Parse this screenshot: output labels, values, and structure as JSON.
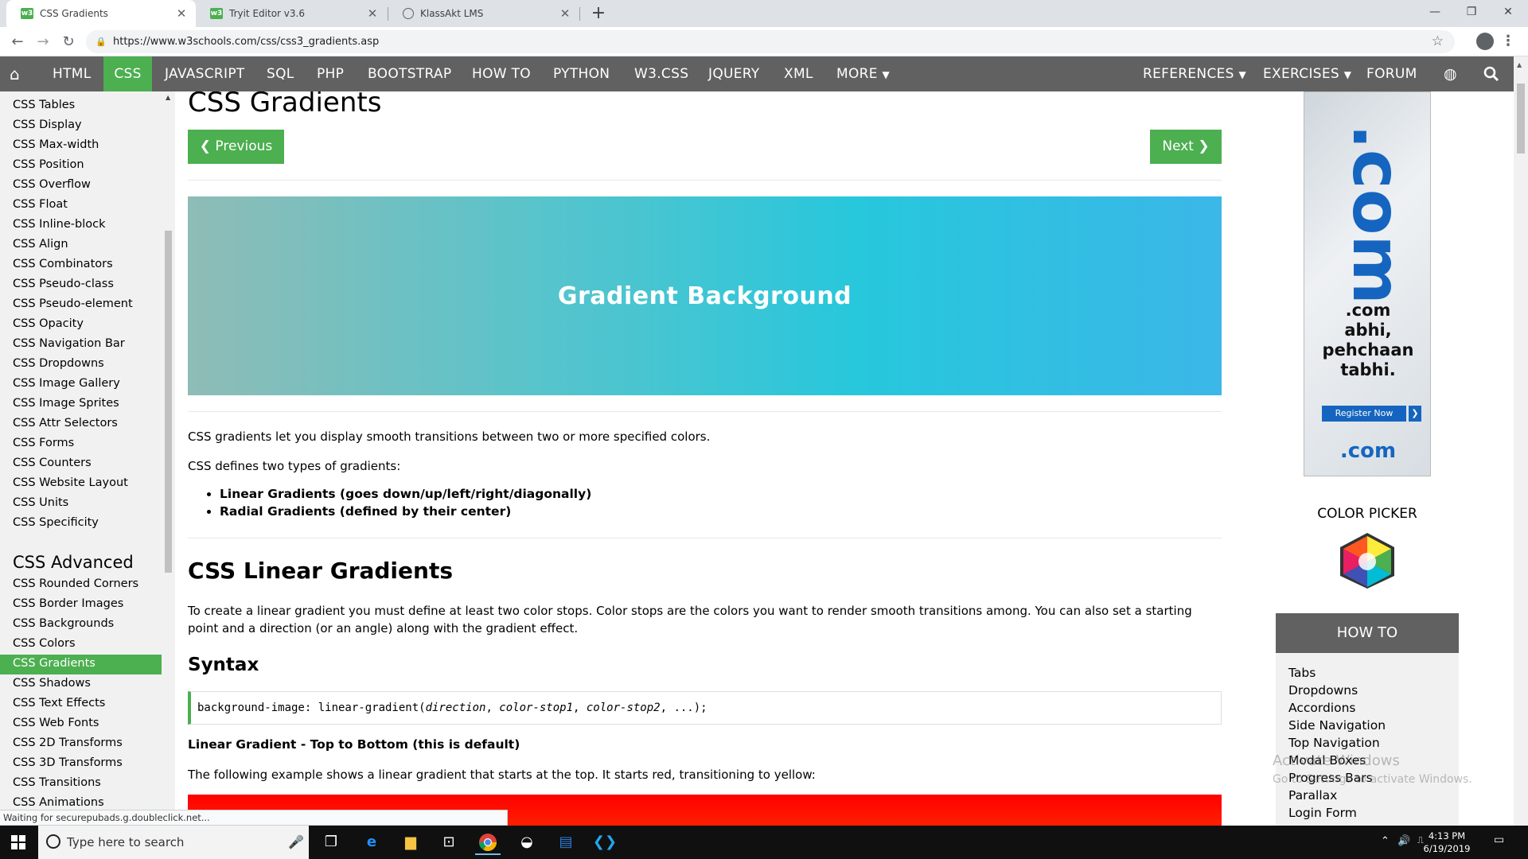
{
  "browser": {
    "tabs": [
      {
        "title": "CSS Gradients",
        "favicon": "w3schools-icon"
      },
      {
        "title": "Tryit Editor v3.6",
        "favicon": "w3schools-icon"
      },
      {
        "title": "KlassAkt LMS",
        "favicon": "globe-icon"
      }
    ],
    "url": "https://www.w3schools.com/css/css3_gradients.asp"
  },
  "topnav": {
    "items": [
      "HTML",
      "CSS",
      "JAVASCRIPT",
      "SQL",
      "PHP",
      "BOOTSTRAP",
      "HOW TO",
      "PYTHON",
      "W3.CSS",
      "JQUERY",
      "XML",
      "MORE"
    ],
    "active": "CSS",
    "right": [
      "REFERENCES",
      "EXERCISES",
      "FORUM"
    ]
  },
  "sidebar": {
    "items": [
      "CSS Tables",
      "CSS Display",
      "CSS Max-width",
      "CSS Position",
      "CSS Overflow",
      "CSS Float",
      "CSS Inline-block",
      "CSS Align",
      "CSS Combinators",
      "CSS Pseudo-class",
      "CSS Pseudo-element",
      "CSS Opacity",
      "CSS Navigation Bar",
      "CSS Dropdowns",
      "CSS Image Gallery",
      "CSS Image Sprites",
      "CSS Attr Selectors",
      "CSS Forms",
      "CSS Counters",
      "CSS Website Layout",
      "CSS Units",
      "CSS Specificity"
    ],
    "heading": "CSS Advanced",
    "advanced": [
      "CSS Rounded Corners",
      "CSS Border Images",
      "CSS Backgrounds",
      "CSS Colors",
      "CSS Gradients",
      "CSS Shadows",
      "CSS Text Effects",
      "CSS Web Fonts",
      "CSS 2D Transforms",
      "CSS 3D Transforms",
      "CSS Transitions",
      "CSS Animations"
    ],
    "active": "CSS Gradients"
  },
  "main": {
    "title": "CSS Gradients",
    "prev_label": "❮ Previous",
    "next_label": "Next ❯",
    "gradient_text": "Gradient Background",
    "intro1": "CSS gradients let you display smooth transitions between two or more specified colors.",
    "intro2": "CSS defines two types of gradients:",
    "types": [
      "Linear Gradients (goes down/up/left/right/diagonally)",
      "Radial Gradients (defined by their center)"
    ],
    "linear_heading": "CSS Linear Gradients",
    "linear_p1": "To create a linear gradient you must define at least two color stops. Color stops are the colors you want to render smooth transitions among. You can also set a starting",
    "linear_p2": "point and a direction (or an angle) along with the gradient effect.",
    "syntax_heading": "Syntax",
    "code": {
      "prefix": "background-image: linear-gradient(",
      "arg1": "direction",
      "sep1": ", ",
      "arg2": "color-stop1",
      "sep2": ", ",
      "arg3": "color-stop2",
      "suffix": ", ...);"
    },
    "example_title": "Linear Gradient - Top to Bottom (this is default)",
    "example_desc": "The following example shows a linear gradient that starts at the top. It starts red, transitioning to yellow:"
  },
  "right": {
    "ad": {
      "brand": ".com",
      "tagline_lines": [
        ".com",
        "abhi,",
        "pehchaan",
        "tabhi."
      ],
      "cta": "Register Now",
      "footer": ".com"
    },
    "color_picker_label": "COLOR PICKER",
    "howto": {
      "heading": "HOW TO",
      "items": [
        "Tabs",
        "Dropdowns",
        "Accordions",
        "Side Navigation",
        "Top Navigation",
        "Modal Boxes",
        "Progress Bars",
        "Parallax",
        "Login Form"
      ]
    },
    "watermark": {
      "line1": "Activate Windows",
      "line2": "Go to Settings to activate Windows."
    }
  },
  "status_text": "Waiting for securepubads.g.doubleclick.net...",
  "taskbar": {
    "search_placeholder": "Type here to search",
    "time": "4:13 PM",
    "date": "6/19/2019"
  },
  "colors": {
    "accent": "#4caf50",
    "nav": "#616161",
    "sidebar": "#f1f1f1"
  }
}
